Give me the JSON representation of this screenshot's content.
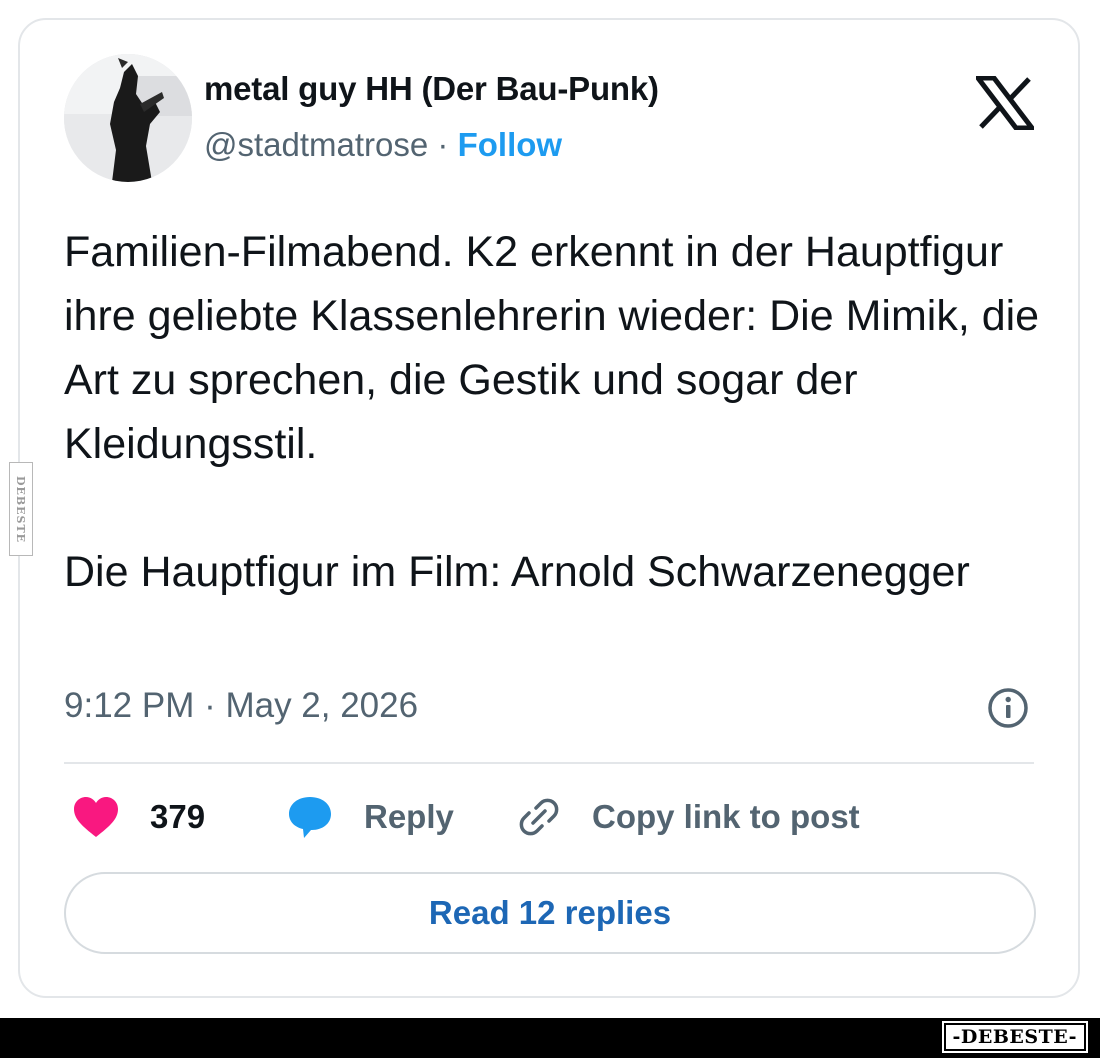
{
  "tweet": {
    "author_name": "metal guy HH (Der Bau-Punk)",
    "handle": "@stadtmatrose",
    "separator": "·",
    "follow_label": "Follow",
    "text_paragraphs": [
      "Familien-Filmabend. K2 erkennt in der Hauptfigur ihre geliebte Klassenlehrerin wieder: Die Mimik, die Art zu sprechen, die Gestik und sogar der Kleidungsstil.",
      "Die Hauptfigur im Film: Arnold Schwarzenegger"
    ],
    "timestamp": "9:12 PM · May 2, 2026"
  },
  "actions": {
    "like_count": "379",
    "reply_label": "Reply",
    "copy_label": "Copy link to post"
  },
  "read_replies_label": "Read 12 replies",
  "watermark": {
    "side_text": "DEBESTE",
    "footer_text": "-DEBESTE-"
  },
  "colors": {
    "accent": "#1d9bf0",
    "like": "#f91880",
    "text": "#0f1419",
    "muted": "#536471",
    "border": "#e3e6e9"
  },
  "icons": {
    "platform": "x-logo-icon",
    "info": "info-icon",
    "like": "heart-icon",
    "reply": "speech-bubble-icon",
    "copy": "link-icon"
  }
}
